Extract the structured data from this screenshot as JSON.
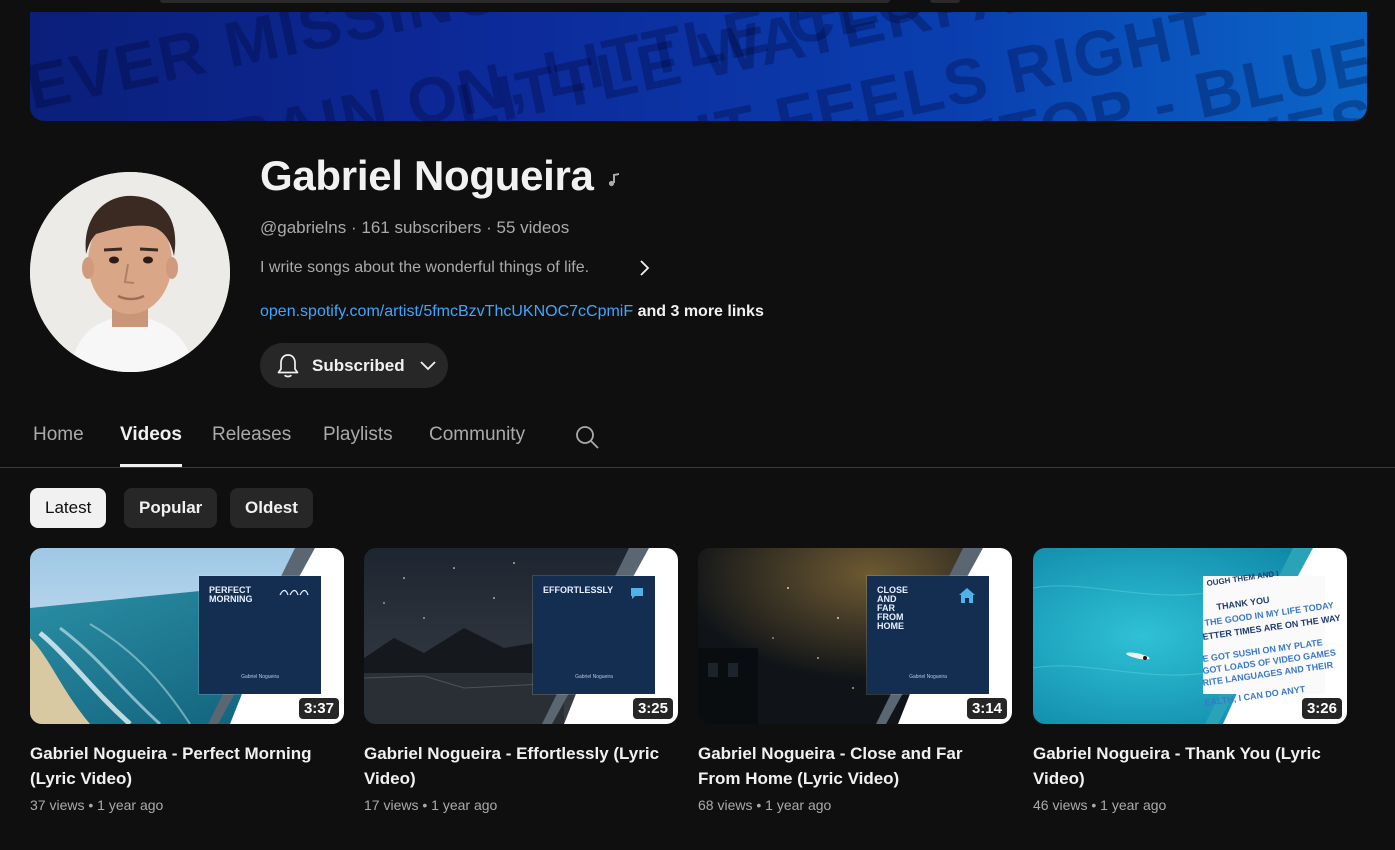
{
  "channel": {
    "name": "Gabriel Nogueira",
    "handle": "@gabrielns",
    "subscribers": "161 subscribers",
    "video_count": "55 videos",
    "meta_sep": " · ",
    "description": "I write songs about the wonderful things of life.",
    "link": "open.spotify.com/artist/5fmcBzvThcUKNOC7cCpmiF",
    "more_links": " and 3 more links",
    "subscribe_label": "Subscribed"
  },
  "banner": {
    "lines": [
      "EVER MISSING",
      "RAIN ON, LITTLE CLOUD",
      "LITTLE WATERFALL",
      "IT FEELS RIGHT",
      "CKTOP - BLUE CAYENNE",
      "SHIEST SUN"
    ]
  },
  "tabs": [
    "Home",
    "Videos",
    "Releases",
    "Playlists",
    "Community"
  ],
  "active_tab": "Videos",
  "sort_chips": [
    "Latest",
    "Popular",
    "Oldest"
  ],
  "videos": [
    {
      "title": "Gabriel Nogueira - Perfect Morning (Lyric Video)",
      "views": "37 views",
      "age": "1 year ago",
      "duration": "3:37",
      "album_title": "PERFECT\nMORNING",
      "album_artist": "Gabriel Nogueira"
    },
    {
      "title": "Gabriel Nogueira - Effortlessly (Lyric Video)",
      "views": "17 views",
      "age": "1 year ago",
      "duration": "3:25",
      "album_title": "EFFORTLESSLY",
      "album_artist": "Gabriel Nogueira"
    },
    {
      "title": "Gabriel Nogueira - Close and Far From Home (Lyric Video)",
      "views": "68 views",
      "age": "1 year ago",
      "duration": "3:14",
      "album_title": "CLOSE\nAND\nFAR\nFROM\nHOME",
      "album_artist": "Gabriel Nogueira"
    },
    {
      "title": "Gabriel Nogueira - Thank You (Lyric Video)",
      "views": "46 views",
      "age": "1 year ago",
      "duration": "3:26",
      "album_title": "",
      "album_artist": ""
    }
  ],
  "video_meta_sep": " • ",
  "icons": {
    "music": "music-note-icon",
    "chevron_right": "chevron-right-icon",
    "bell": "bell-icon",
    "chevron_down": "chevron-down-icon",
    "search": "search-icon"
  },
  "colors": {
    "background": "#0f0f0f",
    "link": "#3ea6ff",
    "secondary_text": "#aaaaaa",
    "chip": "#272727"
  }
}
